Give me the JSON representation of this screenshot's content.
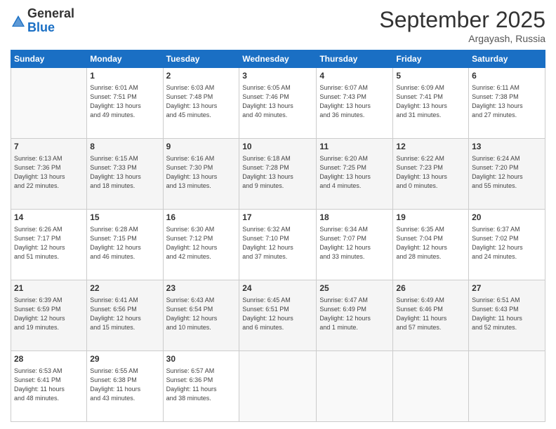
{
  "logo": {
    "general": "General",
    "blue": "Blue"
  },
  "header": {
    "month": "September 2025",
    "location": "Argayash, Russia"
  },
  "weekdays": [
    "Sunday",
    "Monday",
    "Tuesday",
    "Wednesday",
    "Thursday",
    "Friday",
    "Saturday"
  ],
  "weeks": [
    [
      {
        "day": "",
        "info": ""
      },
      {
        "day": "1",
        "info": "Sunrise: 6:01 AM\nSunset: 7:51 PM\nDaylight: 13 hours\nand 49 minutes."
      },
      {
        "day": "2",
        "info": "Sunrise: 6:03 AM\nSunset: 7:48 PM\nDaylight: 13 hours\nand 45 minutes."
      },
      {
        "day": "3",
        "info": "Sunrise: 6:05 AM\nSunset: 7:46 PM\nDaylight: 13 hours\nand 40 minutes."
      },
      {
        "day": "4",
        "info": "Sunrise: 6:07 AM\nSunset: 7:43 PM\nDaylight: 13 hours\nand 36 minutes."
      },
      {
        "day": "5",
        "info": "Sunrise: 6:09 AM\nSunset: 7:41 PM\nDaylight: 13 hours\nand 31 minutes."
      },
      {
        "day": "6",
        "info": "Sunrise: 6:11 AM\nSunset: 7:38 PM\nDaylight: 13 hours\nand 27 minutes."
      }
    ],
    [
      {
        "day": "7",
        "info": "Sunrise: 6:13 AM\nSunset: 7:36 PM\nDaylight: 13 hours\nand 22 minutes."
      },
      {
        "day": "8",
        "info": "Sunrise: 6:15 AM\nSunset: 7:33 PM\nDaylight: 13 hours\nand 18 minutes."
      },
      {
        "day": "9",
        "info": "Sunrise: 6:16 AM\nSunset: 7:30 PM\nDaylight: 13 hours\nand 13 minutes."
      },
      {
        "day": "10",
        "info": "Sunrise: 6:18 AM\nSunset: 7:28 PM\nDaylight: 13 hours\nand 9 minutes."
      },
      {
        "day": "11",
        "info": "Sunrise: 6:20 AM\nSunset: 7:25 PM\nDaylight: 13 hours\nand 4 minutes."
      },
      {
        "day": "12",
        "info": "Sunrise: 6:22 AM\nSunset: 7:23 PM\nDaylight: 13 hours\nand 0 minutes."
      },
      {
        "day": "13",
        "info": "Sunrise: 6:24 AM\nSunset: 7:20 PM\nDaylight: 12 hours\nand 55 minutes."
      }
    ],
    [
      {
        "day": "14",
        "info": "Sunrise: 6:26 AM\nSunset: 7:17 PM\nDaylight: 12 hours\nand 51 minutes."
      },
      {
        "day": "15",
        "info": "Sunrise: 6:28 AM\nSunset: 7:15 PM\nDaylight: 12 hours\nand 46 minutes."
      },
      {
        "day": "16",
        "info": "Sunrise: 6:30 AM\nSunset: 7:12 PM\nDaylight: 12 hours\nand 42 minutes."
      },
      {
        "day": "17",
        "info": "Sunrise: 6:32 AM\nSunset: 7:10 PM\nDaylight: 12 hours\nand 37 minutes."
      },
      {
        "day": "18",
        "info": "Sunrise: 6:34 AM\nSunset: 7:07 PM\nDaylight: 12 hours\nand 33 minutes."
      },
      {
        "day": "19",
        "info": "Sunrise: 6:35 AM\nSunset: 7:04 PM\nDaylight: 12 hours\nand 28 minutes."
      },
      {
        "day": "20",
        "info": "Sunrise: 6:37 AM\nSunset: 7:02 PM\nDaylight: 12 hours\nand 24 minutes."
      }
    ],
    [
      {
        "day": "21",
        "info": "Sunrise: 6:39 AM\nSunset: 6:59 PM\nDaylight: 12 hours\nand 19 minutes."
      },
      {
        "day": "22",
        "info": "Sunrise: 6:41 AM\nSunset: 6:56 PM\nDaylight: 12 hours\nand 15 minutes."
      },
      {
        "day": "23",
        "info": "Sunrise: 6:43 AM\nSunset: 6:54 PM\nDaylight: 12 hours\nand 10 minutes."
      },
      {
        "day": "24",
        "info": "Sunrise: 6:45 AM\nSunset: 6:51 PM\nDaylight: 12 hours\nand 6 minutes."
      },
      {
        "day": "25",
        "info": "Sunrise: 6:47 AM\nSunset: 6:49 PM\nDaylight: 12 hours\nand 1 minute."
      },
      {
        "day": "26",
        "info": "Sunrise: 6:49 AM\nSunset: 6:46 PM\nDaylight: 11 hours\nand 57 minutes."
      },
      {
        "day": "27",
        "info": "Sunrise: 6:51 AM\nSunset: 6:43 PM\nDaylight: 11 hours\nand 52 minutes."
      }
    ],
    [
      {
        "day": "28",
        "info": "Sunrise: 6:53 AM\nSunset: 6:41 PM\nDaylight: 11 hours\nand 48 minutes."
      },
      {
        "day": "29",
        "info": "Sunrise: 6:55 AM\nSunset: 6:38 PM\nDaylight: 11 hours\nand 43 minutes."
      },
      {
        "day": "30",
        "info": "Sunrise: 6:57 AM\nSunset: 6:36 PM\nDaylight: 11 hours\nand 38 minutes."
      },
      {
        "day": "",
        "info": ""
      },
      {
        "day": "",
        "info": ""
      },
      {
        "day": "",
        "info": ""
      },
      {
        "day": "",
        "info": ""
      }
    ]
  ]
}
